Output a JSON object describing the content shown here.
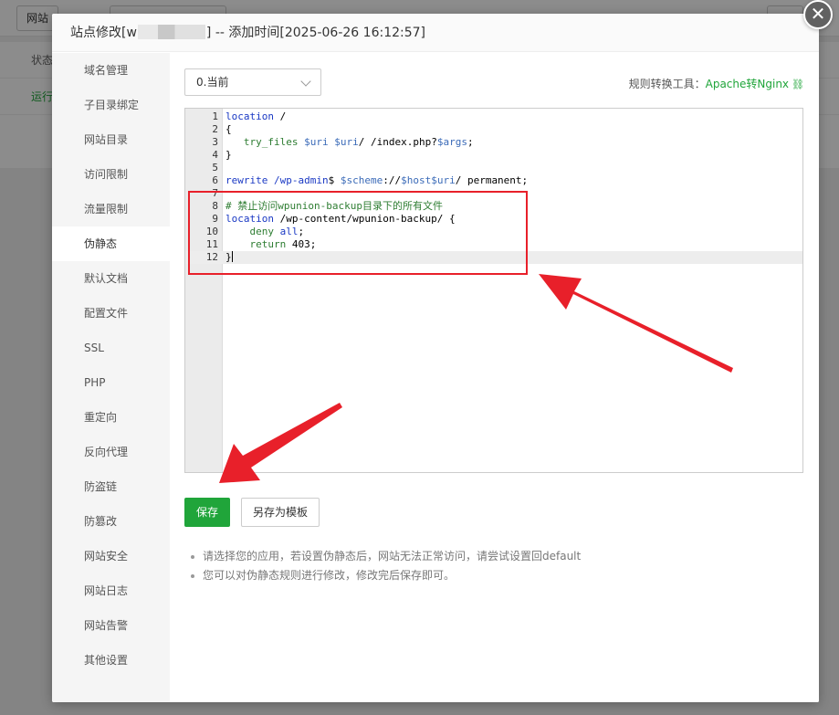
{
  "background": {
    "toolbar_button_1": "网站",
    "status_header": "状态",
    "status_value": "运行"
  },
  "modal": {
    "title_prefix": "站点修改[",
    "title_site": "w",
    "title_suffix": "] -- 添加时间[2025-06-26 16:12:57]",
    "close_glyph": "✕"
  },
  "sidebar": {
    "items": [
      {
        "label": "域名管理"
      },
      {
        "label": "子目录绑定"
      },
      {
        "label": "网站目录"
      },
      {
        "label": "访问限制"
      },
      {
        "label": "流量限制"
      },
      {
        "label": "伪静态"
      },
      {
        "label": "默认文档"
      },
      {
        "label": "配置文件"
      },
      {
        "label": "SSL"
      },
      {
        "label": "PHP"
      },
      {
        "label": "重定向"
      },
      {
        "label": "反向代理"
      },
      {
        "label": "防盗链"
      },
      {
        "label": "防篡改"
      },
      {
        "label": "网站安全"
      },
      {
        "label": "网站日志"
      },
      {
        "label": "网站告警"
      },
      {
        "label": "其他设置"
      }
    ],
    "active_index": 5
  },
  "rewrite": {
    "selected_rule": "0.当前",
    "converter_label": "规则转换工具：",
    "converter_link": "Apache转Nginx",
    "save_label": "保存",
    "save_template_label": "另存为模板",
    "tips": [
      "请选择您的应用，若设置伪静态后，网站无法正常访问，请尝试设置回default",
      "您可以对伪静态规则进行修改，修改完后保存即可。"
    ]
  },
  "editor": {
    "lines": [
      {
        "n": "1",
        "text": "location /"
      },
      {
        "n": "2",
        "text": "{"
      },
      {
        "n": "3",
        "text": "   try_files $uri $uri/ /index.php?$args;"
      },
      {
        "n": "4",
        "text": "}"
      },
      {
        "n": "5",
        "text": ""
      },
      {
        "n": "6",
        "text": "rewrite /wp-admin$ $scheme://$host$uri/ permanent;"
      },
      {
        "n": "7",
        "text": ""
      },
      {
        "n": "8",
        "text": "# 禁止访问wpunion-backup目录下的所有文件"
      },
      {
        "n": "9",
        "text": "location /wp-content/wpunion-backup/ {"
      },
      {
        "n": "10",
        "text": "    deny all;"
      },
      {
        "n": "11",
        "text": "    return 403;"
      },
      {
        "n": "12",
        "text": "}"
      }
    ],
    "active_line": 12
  },
  "colors": {
    "accent_green": "#20a53a",
    "annotation_red": "#e8202a"
  }
}
